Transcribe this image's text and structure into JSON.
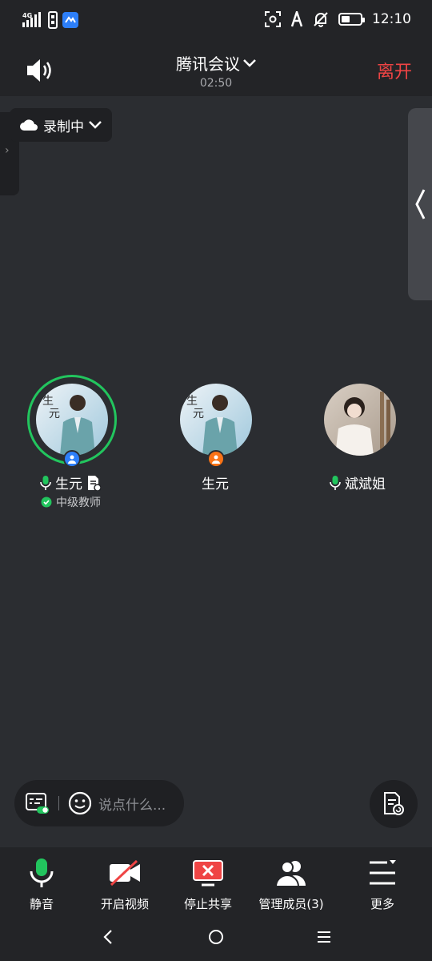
{
  "status_bar": {
    "network": "4G",
    "time": "12:10",
    "battery_level_pct": 45,
    "icons": [
      "signal-icon",
      "sim-icon",
      "app-notification-icon",
      "screenshot-icon",
      "font-icon",
      "mute-bell-icon",
      "battery-icon"
    ]
  },
  "header": {
    "title": "腾讯会议",
    "duration": "02:50",
    "leave_label": "离开",
    "speaker_icon": "speaker-icon"
  },
  "recording": {
    "label": "录制中",
    "icon": "cloud-icon"
  },
  "participants": [
    {
      "name": "生元",
      "role": "中级教师",
      "mic": "active",
      "speaking": true,
      "badge_color": "#2d7ff9",
      "has_doc_icon": true
    },
    {
      "name": "生元",
      "role": "",
      "mic": "none",
      "speaking": false,
      "badge_color": "#f97316",
      "has_doc_icon": false
    },
    {
      "name": "斌斌姐",
      "role": "",
      "mic": "active",
      "speaking": false,
      "badge_color": "",
      "has_doc_icon": false
    }
  ],
  "chat": {
    "placeholder": "说点什么..."
  },
  "toolbar": {
    "items": [
      {
        "label": "静音",
        "icon": "microphone-icon"
      },
      {
        "label": "开启视频",
        "icon": "video-off-icon"
      },
      {
        "label": "停止共享",
        "icon": "stop-share-icon"
      },
      {
        "label": "管理成员(3)",
        "icon": "members-icon"
      },
      {
        "label": "更多",
        "icon": "more-menu-icon"
      }
    ]
  },
  "colors": {
    "background": "#2b2d31",
    "bar": "#232427",
    "leave": "#ef4444",
    "speaking_ring": "#22c55e",
    "mic_active": "#22c55e"
  }
}
